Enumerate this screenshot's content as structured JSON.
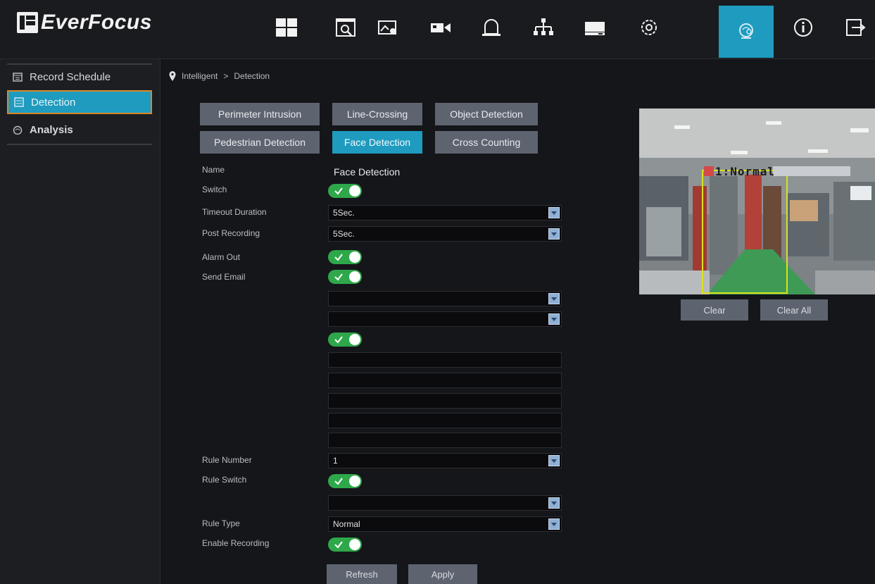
{
  "app": {
    "logo_text": "EverFocus"
  },
  "topnav": {
    "items": [
      {
        "name": "live-view",
        "icon": "grid-icon"
      },
      {
        "name": "playback",
        "icon": "search-playback-icon"
      },
      {
        "name": "image",
        "icon": "image-settings-icon"
      },
      {
        "name": "camera",
        "icon": "camera-icon"
      },
      {
        "name": "alarm",
        "icon": "alarm-bell-icon"
      },
      {
        "name": "network",
        "icon": "network-icon"
      },
      {
        "name": "storage",
        "icon": "hdd-icon"
      },
      {
        "name": "system",
        "icon": "gear-icon"
      },
      {
        "name": "intelligent",
        "icon": "face-ai-icon",
        "active": true
      },
      {
        "name": "info",
        "icon": "info-icon"
      },
      {
        "name": "logout",
        "icon": "logout-icon"
      }
    ]
  },
  "sidebar": {
    "items": [
      {
        "label": "Record Schedule",
        "icon": "calendar-icon"
      },
      {
        "label": "Detection",
        "icon": "detection-icon",
        "active": true
      },
      {
        "label": "Analysis",
        "icon": "analysis-icon"
      }
    ]
  },
  "breadcrumb": {
    "root": "Intelligent",
    "separator": ">",
    "current": "Detection"
  },
  "tabs": [
    {
      "label": "Perimeter Intrusion"
    },
    {
      "label": "Line-Crossing"
    },
    {
      "label": "Object Detection"
    },
    {
      "label": "Pedestrian Detection"
    },
    {
      "label": "Face Detection",
      "active": true
    },
    {
      "label": "Cross Counting"
    }
  ],
  "form": {
    "name_label": "Name",
    "name_value": "Face Detection",
    "switch_label": "Switch",
    "switch_on": true,
    "timeout_label": "Timeout Duration",
    "timeout_value": "5Sec.",
    "post_recording_label": "Post Recording",
    "post_recording_value": "5Sec.",
    "alarm_out_label": "Alarm Out",
    "alarm_out_on": true,
    "send_email_label": "Send Email",
    "send_email_on": true,
    "rule_number_label": "Rule Number",
    "rule_number_value": "1",
    "rule_switch_label": "Rule Switch",
    "rule_switch_on": true,
    "rule_type_label": "Rule Type",
    "rule_type_value": "Normal",
    "enable_recording_label": "Enable Recording",
    "enable_recording_on": true
  },
  "buttons": {
    "refresh": "Refresh",
    "apply": "Apply",
    "clear": "Clear",
    "clear_all": "Clear All"
  },
  "preview": {
    "rule_overlay": "1:Normal",
    "accent_color": "#1e9bbf",
    "rule_box_color": "#d8e21a"
  }
}
